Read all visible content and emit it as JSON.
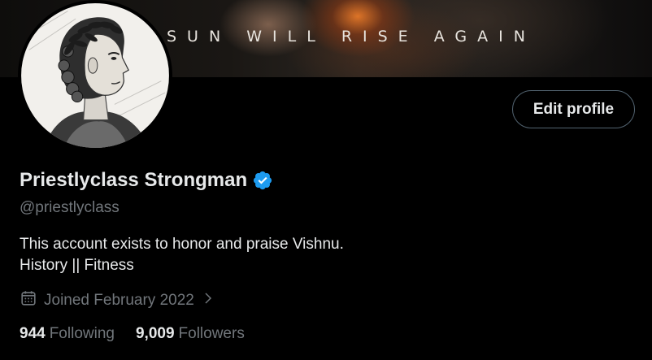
{
  "banner": {
    "text": "SUN WILL RISE AGAIN"
  },
  "profile": {
    "display_name": "Priestlyclass Strongman",
    "handle": "@priestlyclass",
    "bio_line1": "This account exists to honor and praise Vishnu.",
    "bio_line2": "History || Fitness",
    "joined": "Joined February 2022",
    "verified_icon": "verified-badge-icon",
    "verified_color": "#1d9bf0"
  },
  "actions": {
    "edit_label": "Edit profile"
  },
  "stats": {
    "following_count": "944",
    "following_label": "Following",
    "followers_count": "9,009",
    "followers_label": "Followers"
  },
  "colors": {
    "background": "#000000",
    "primary_text": "#e7e9ea",
    "secondary_text": "#71767b",
    "border": "#536471"
  }
}
